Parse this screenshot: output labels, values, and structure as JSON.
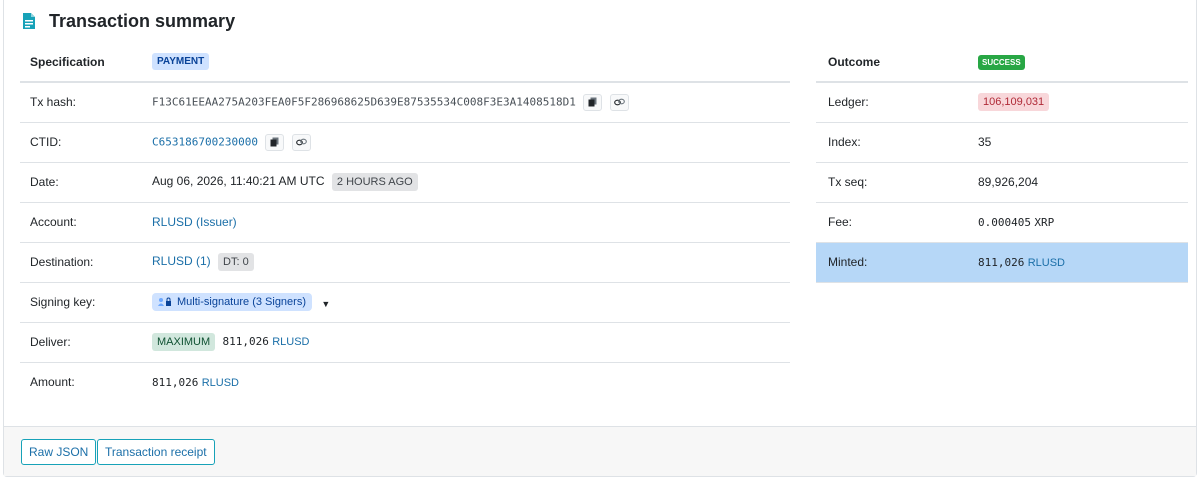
{
  "title": "Transaction summary",
  "left": {
    "header": {
      "key": "Specification",
      "badge": "PAYMENT"
    },
    "tx_hash": {
      "key": "Tx hash:",
      "value": "F13C61EEAA275A203FEA0F5F286968625D639E87535534C008F3E3A1408518D1"
    },
    "ctid": {
      "key": "CTID:",
      "value": "C653186700230000"
    },
    "date": {
      "key": "Date:",
      "value": "Aug 06, 2026, 11:40:21 AM UTC",
      "badge": "2 HOURS AGO"
    },
    "account": {
      "key": "Account:",
      "value": "RLUSD (Issuer)"
    },
    "destination": {
      "key": "Destination:",
      "value": "RLUSD (1)",
      "badge": "DT: 0"
    },
    "signing_key": {
      "key": "Signing key:",
      "value": "Multi-signature (3 Signers)"
    },
    "deliver": {
      "key": "Deliver:",
      "badge": "MAXIMUM",
      "amount": "811,026",
      "currency": "RLUSD"
    },
    "amount": {
      "key": "Amount:",
      "amount": "811,026",
      "currency": "RLUSD"
    }
  },
  "right": {
    "header": {
      "key": "Outcome",
      "badge": "SUCCESS"
    },
    "ledger": {
      "key": "Ledger:",
      "value": "106,109,031"
    },
    "index": {
      "key": "Index:",
      "value": "35"
    },
    "tx_seq": {
      "key": "Tx seq:",
      "value": "89,926,204"
    },
    "fee": {
      "key": "Fee:",
      "value": "0.000405",
      "currency": "XRP"
    },
    "minted": {
      "key": "Minted:",
      "amount": "811,026",
      "currency": "RLUSD"
    }
  },
  "footer": {
    "raw_json": "Raw JSON",
    "receipt": "Transaction receipt"
  },
  "colors": {
    "accent": "#1b6fa8",
    "highlight": "#b6d7f7",
    "success": "#28a745"
  },
  "icons": [
    "document-icon",
    "copy-icon",
    "link-icon",
    "multisig-icon",
    "caret-down-icon"
  ]
}
